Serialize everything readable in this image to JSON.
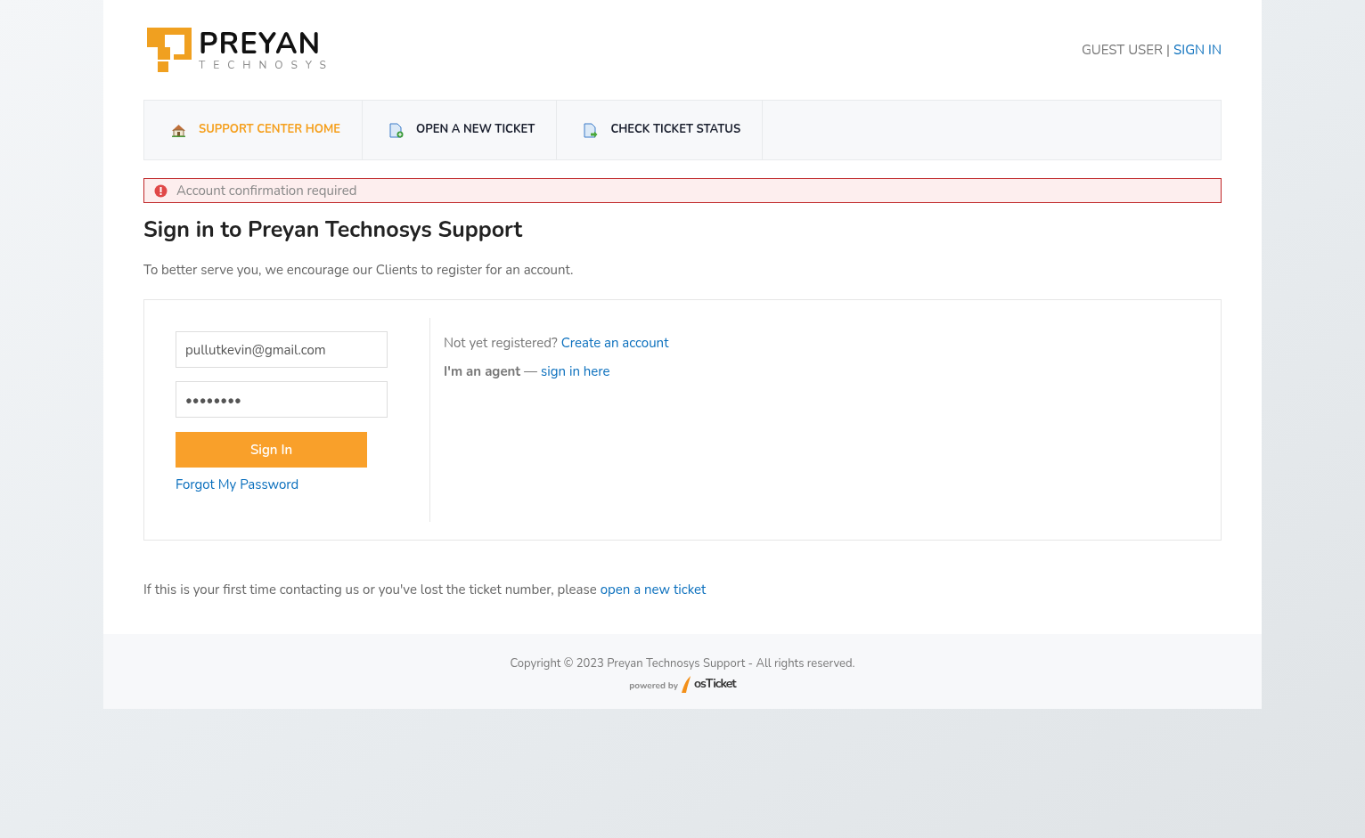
{
  "logo": {
    "name": "PREYAN",
    "tagline": "TECHNOSYS"
  },
  "user_bar": {
    "guest": "GUEST USER",
    "separator": "|",
    "sign_in": "SIGN IN"
  },
  "nav": [
    {
      "label": "SUPPORT CENTER HOME",
      "kind": "home",
      "selected": true
    },
    {
      "label": "OPEN A NEW TICKET",
      "kind": "new",
      "selected": false
    },
    {
      "label": "CHECK TICKET STATUS",
      "kind": "status",
      "selected": false
    }
  ],
  "alert": {
    "text": "Account confirmation required"
  },
  "heading": "Sign in to Preyan Technosys Support",
  "intro": "To better serve you, we encourage our Clients to register for an account.",
  "form": {
    "email": "pullutkevin@gmail.com",
    "password": "••••••••",
    "submit": "Sign In",
    "forgot": "Forgot My Password"
  },
  "side": {
    "not_registered": "Not yet registered?",
    "create": "Create an account",
    "agent": "I'm an agent",
    "dash": "—",
    "agent_link": "sign in here"
  },
  "first_time": {
    "text": "If this is your first time contacting us or you've lost the ticket number, please",
    "link": "open a new ticket"
  },
  "footer": {
    "copyright": "Copyright © 2023 Preyan Technosys Support - All rights reserved.",
    "powered": "powered by",
    "brand_os": "os",
    "brand_ticket": "Ticket"
  }
}
